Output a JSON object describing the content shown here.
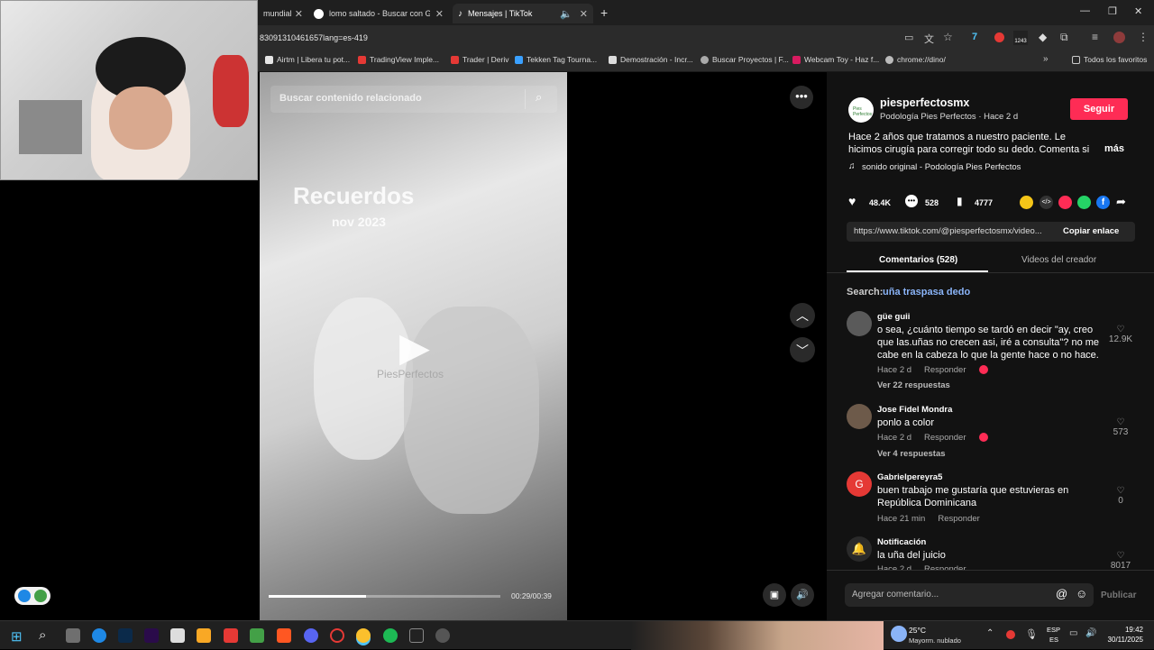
{
  "browser": {
    "tabs": [
      {
        "label": "mundial"
      },
      {
        "label": "lomo saltado - Buscar con Goo"
      },
      {
        "label": "Mensajes | TikTok"
      }
    ],
    "url": "83091310461657lang=es-419",
    "new_tab": "+",
    "bookmarks": [
      {
        "label": "Airtm | Libera tu pot...",
        "color": "#e6e6e6"
      },
      {
        "label": "TradingView Imple...",
        "color": "#e53935"
      },
      {
        "label": "Trader | Deriv",
        "color": "#e53935"
      },
      {
        "label": "Tekken Tag Tourna...",
        "color": "#3aa0ff"
      },
      {
        "label": "Demostración - Incr...",
        "color": "#dddddd"
      },
      {
        "label": "Buscar Proyectos | F...",
        "color": "#aaaaaa"
      },
      {
        "label": "Webcam Toy - Haz f...",
        "color": "#d81b60"
      },
      {
        "label": "chrome://dino/",
        "color": "#bbbbbb"
      }
    ],
    "all_bookmarks": "Todos los favoritos",
    "ext_badge": "1243"
  },
  "video": {
    "search_placeholder": "Buscar contenido relacionado",
    "overlay_title": "Recuerdos",
    "overlay_date": "nov 2023",
    "watermark": "PiesPerfectos",
    "time": "00:29/00:39",
    "progress": 0.42
  },
  "creator": {
    "username": "piesperfectosmx",
    "subtitle": "Podología Pies Perfectos · Hace 2 d",
    "follow": "Seguir",
    "avatar_label": "Pies Perfectos",
    "description": "Hace 2 años que tratamos a nuestro paciente. Le hicimos cirugía para corregir todo su dedo. Comenta si quieres...",
    "more": "más",
    "sound": "sonido original - Podología Pies Perfectos"
  },
  "stats": {
    "likes": "48.4K",
    "comments": "528",
    "saves": "4777"
  },
  "link": {
    "url": "https://www.tiktok.com/@piesperfectosmx/video...",
    "copy": "Copiar enlace"
  },
  "panel_tabs": [
    {
      "label": "Comentarios (528)"
    },
    {
      "label": "Videos del creador"
    }
  ],
  "search_hint": {
    "prefix": "Search:",
    "query": "uña traspasa dedo"
  },
  "comments": [
    {
      "name": "güe guii",
      "text": "o sea, ¿cuánto tiempo se tardó en decir \"ay, creo que las.uñas no crecen asi, iré a consulta\"? no me cabe en la cabeza lo que la gente hace o no hace.",
      "time": "Hace 2 d",
      "reply": "Responder",
      "likes": "12.9K",
      "replies": "Ver 22 respuestas",
      "avatar_color": "#5a5a5a"
    },
    {
      "name": "Jose Fidel Mondra",
      "text": "ponlo a color",
      "time": "Hace 2 d",
      "reply": "Responder",
      "likes": "573",
      "replies": "Ver 4 respuestas",
      "avatar_color": "#6d5a4a"
    },
    {
      "name": "Gabrielpereyra5",
      "text": "buen trabajo me gustaría que estuvieras en República Dominicana",
      "time": "Hace 21 min",
      "reply": "Responder",
      "likes": "0",
      "replies": "",
      "avatar_color": "#e53935",
      "avatar_letter": "G"
    },
    {
      "name": "Notificación",
      "text": "la uña del juicio",
      "time": "Hace 2 d",
      "reply": "Responder",
      "likes": "8017",
      "replies": "",
      "avatar_color": "#2a2a2a"
    }
  ],
  "composer": {
    "placeholder": "Agregar comentario...",
    "post": "Publicar"
  },
  "taskbar": {
    "weather_temp": "25°C",
    "weather_desc": "Mayorm. nublado",
    "lang1": "ESP",
    "lang2": "ES",
    "time": "19:42",
    "date": "30/11/2025"
  }
}
